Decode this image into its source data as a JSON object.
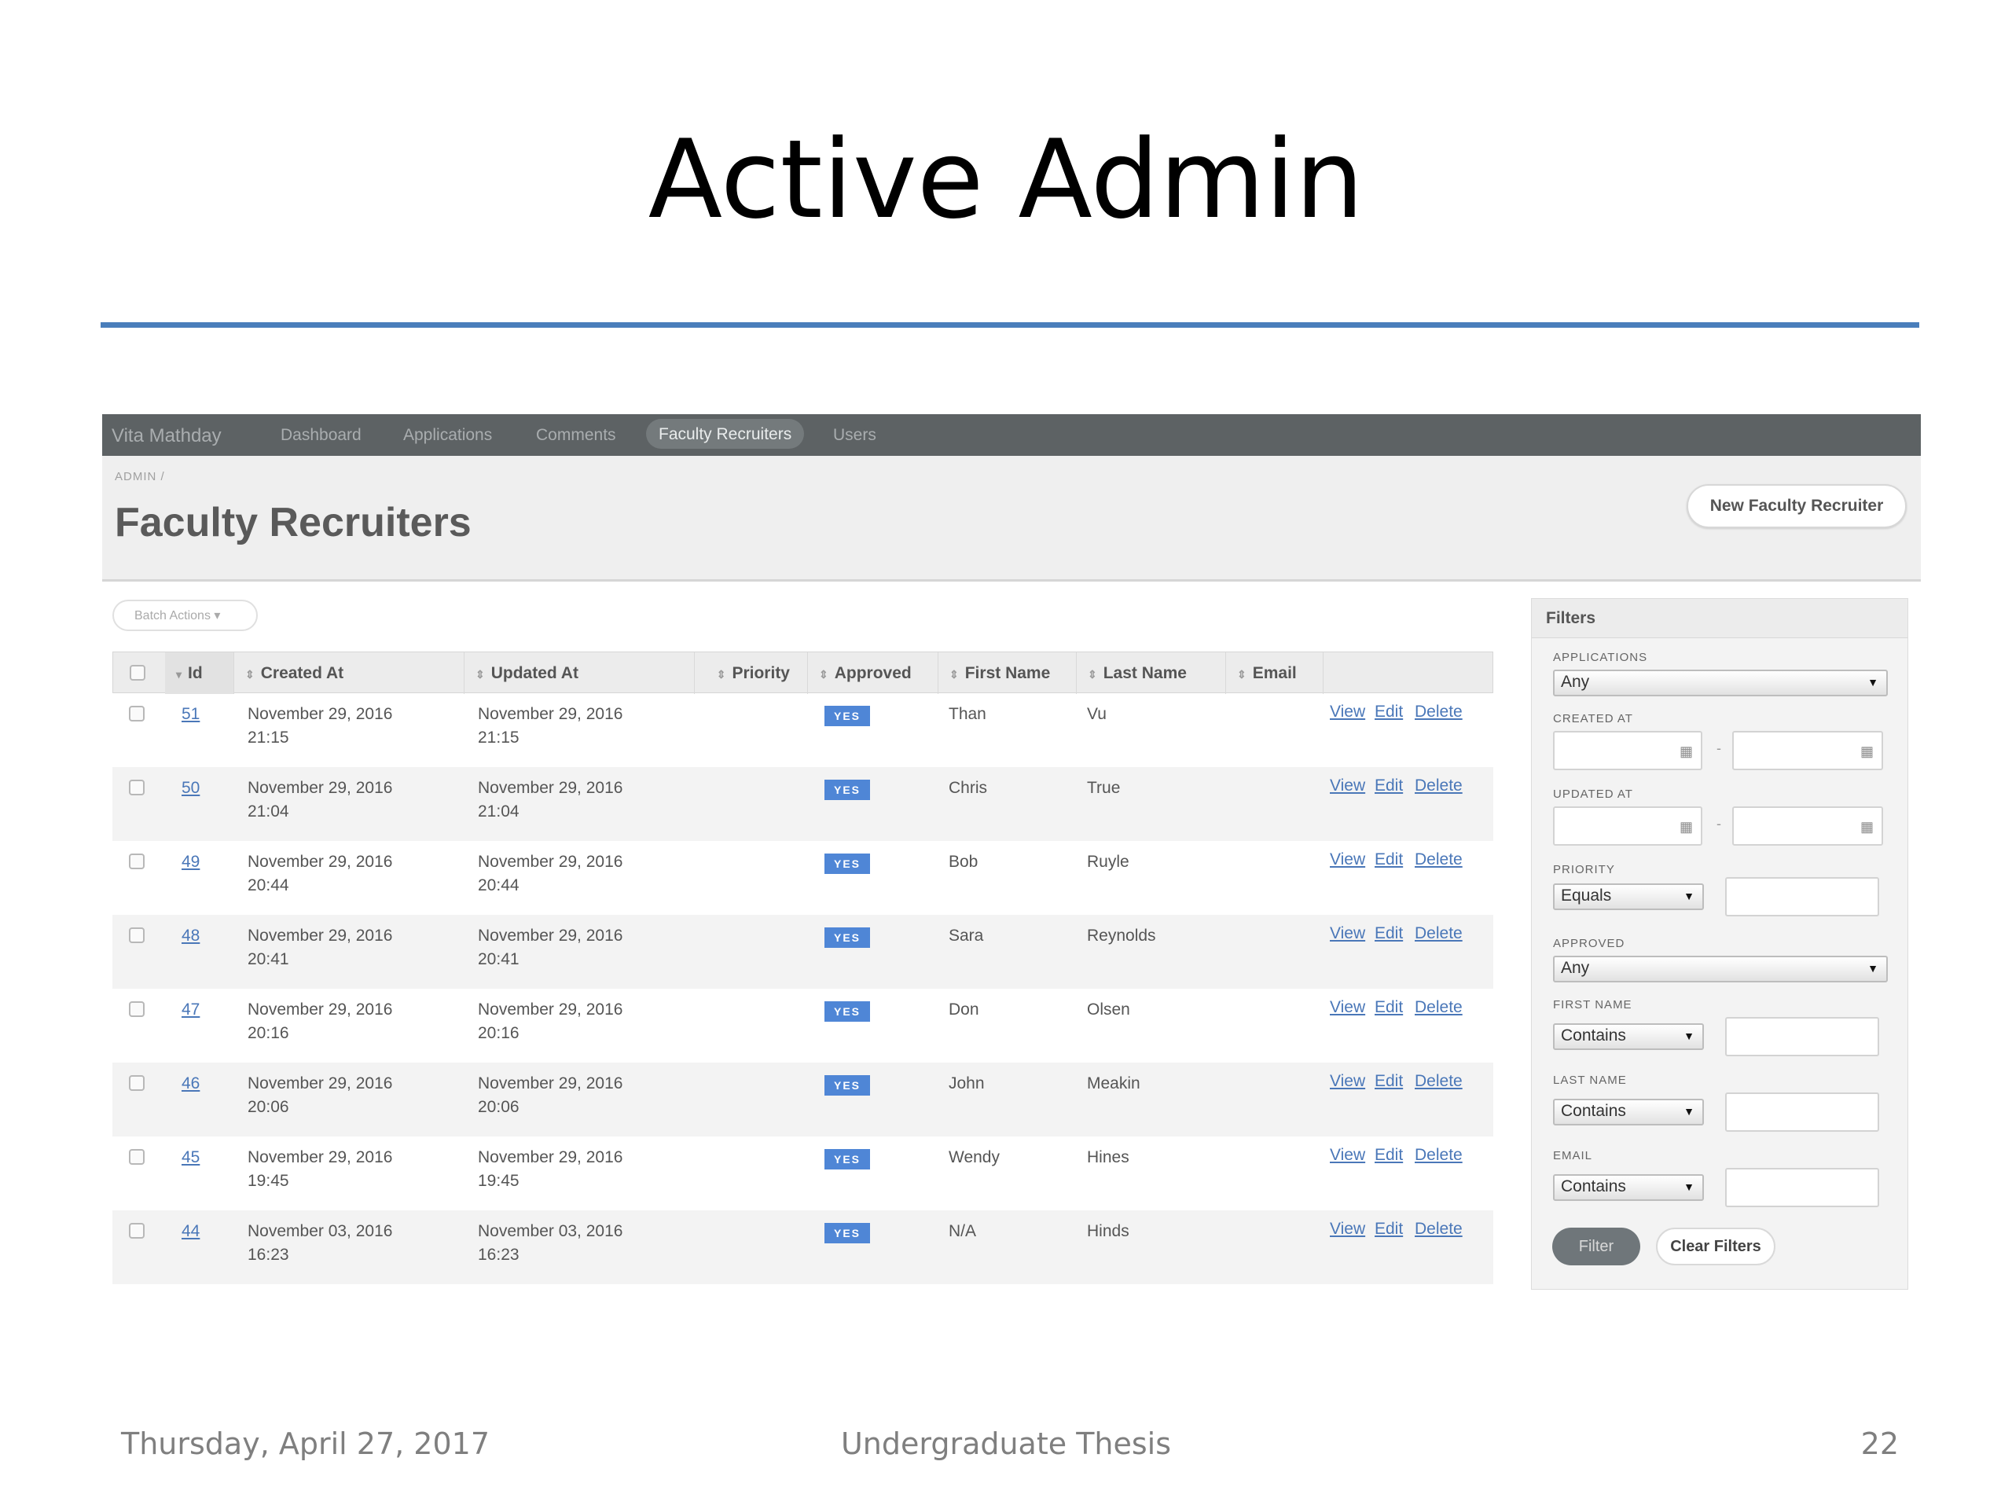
{
  "slide": {
    "title": "Active Admin",
    "footer_date": "Thursday, April 27, 2017",
    "footer_center": "Undergraduate Thesis",
    "page_number": "22"
  },
  "admin": {
    "brand": "Vita Mathday",
    "nav": [
      "Dashboard",
      "Applications",
      "Comments",
      "Faculty Recruiters",
      "Users"
    ],
    "nav_active": "Faculty Recruiters",
    "breadcrumb": "ADMIN /",
    "page_title": "Faculty Recruiters",
    "new_button": "New Faculty Recruiter",
    "batch_actions": "Batch Actions ▾",
    "table": {
      "columns": [
        "Id",
        "Created At",
        "Updated At",
        "Priority",
        "Approved",
        "First Name",
        "Last Name",
        "Email"
      ],
      "rows": [
        {
          "id": "51",
          "created": "November 29, 2016",
          "created_time": "21:15",
          "updated": "November 29, 2016",
          "updated_time": "21:15",
          "approved": "YES",
          "first": "Than",
          "last": "Vu"
        },
        {
          "id": "50",
          "created": "November 29, 2016",
          "created_time": "21:04",
          "updated": "November 29, 2016",
          "updated_time": "21:04",
          "approved": "YES",
          "first": "Chris",
          "last": "True"
        },
        {
          "id": "49",
          "created": "November 29, 2016",
          "created_time": "20:44",
          "updated": "November 29, 2016",
          "updated_time": "20:44",
          "approved": "YES",
          "first": "Bob",
          "last": "Ruyle"
        },
        {
          "id": "48",
          "created": "November 29, 2016",
          "created_time": "20:41",
          "updated": "November 29, 2016",
          "updated_time": "20:41",
          "approved": "YES",
          "first": "Sara",
          "last": "Reynolds"
        },
        {
          "id": "47",
          "created": "November 29, 2016",
          "created_time": "20:16",
          "updated": "November 29, 2016",
          "updated_time": "20:16",
          "approved": "YES",
          "first": "Don",
          "last": "Olsen"
        },
        {
          "id": "46",
          "created": "November 29, 2016",
          "created_time": "20:06",
          "updated": "November 29, 2016",
          "updated_time": "20:06",
          "approved": "YES",
          "first": "John",
          "last": "Meakin"
        },
        {
          "id": "45",
          "created": "November 29, 2016",
          "created_time": "19:45",
          "updated": "November 29, 2016",
          "updated_time": "19:45",
          "approved": "YES",
          "first": "Wendy",
          "last": "Hines"
        },
        {
          "id": "44",
          "created": "November 03, 2016",
          "created_time": "16:23",
          "updated": "November 03, 2016",
          "updated_time": "16:23",
          "approved": "YES",
          "first": "N/A",
          "last": "Hinds"
        }
      ],
      "actions": [
        "View",
        "Edit",
        "Delete"
      ]
    },
    "filters": {
      "title": "Filters",
      "applications_label": "APPLICATIONS",
      "applications_value": "Any",
      "created_label": "CREATED AT",
      "updated_label": "UPDATED AT",
      "priority_label": "PRIORITY",
      "priority_value": "Equals",
      "approved_label": "APPROVED",
      "approved_value": "Any",
      "first_name_label": "FIRST NAME",
      "first_name_value": "Contains",
      "last_name_label": "LAST NAME",
      "last_name_value": "Contains",
      "email_label": "EMAIL",
      "email_value": "Contains",
      "filter_button": "Filter",
      "clear_button": "Clear Filters"
    }
  }
}
